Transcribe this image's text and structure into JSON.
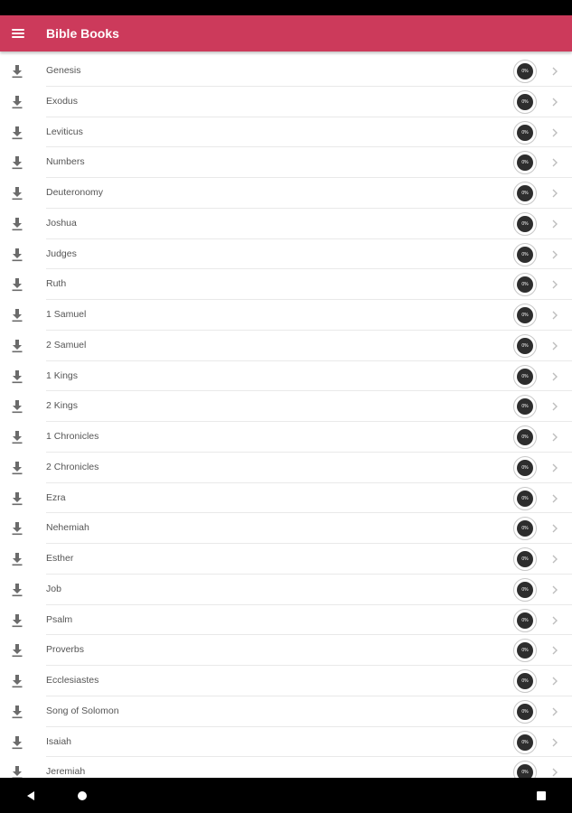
{
  "theme": {
    "accent": "#cc3a5b",
    "text": "#555555",
    "divider": "#e9e9e9",
    "progress_fill": "#2d2d2d"
  },
  "app_bar": {
    "title": "Bible Books",
    "menu_icon": "hamburger-menu-icon"
  },
  "books": [
    {
      "name": "Genesis",
      "progress": "0%"
    },
    {
      "name": "Exodus",
      "progress": "0%"
    },
    {
      "name": "Leviticus",
      "progress": "0%"
    },
    {
      "name": "Numbers",
      "progress": "0%"
    },
    {
      "name": "Deuteronomy",
      "progress": "0%"
    },
    {
      "name": "Joshua",
      "progress": "0%"
    },
    {
      "name": "Judges",
      "progress": "0%"
    },
    {
      "name": "Ruth",
      "progress": "0%"
    },
    {
      "name": "1 Samuel",
      "progress": "0%"
    },
    {
      "name": "2 Samuel",
      "progress": "0%"
    },
    {
      "name": "1 Kings",
      "progress": "0%"
    },
    {
      "name": "2 Kings",
      "progress": "0%"
    },
    {
      "name": "1 Chronicles",
      "progress": "0%"
    },
    {
      "name": "2 Chronicles",
      "progress": "0%"
    },
    {
      "name": "Ezra",
      "progress": "0%"
    },
    {
      "name": "Nehemiah",
      "progress": "0%"
    },
    {
      "name": "Esther",
      "progress": "0%"
    },
    {
      "name": "Job",
      "progress": "0%"
    },
    {
      "name": "Psalm",
      "progress": "0%"
    },
    {
      "name": "Proverbs",
      "progress": "0%"
    },
    {
      "name": "Ecclesiastes",
      "progress": "0%"
    },
    {
      "name": "Song of Solomon",
      "progress": "0%"
    },
    {
      "name": "Isaiah",
      "progress": "0%"
    },
    {
      "name": "Jeremiah",
      "progress": "0%"
    }
  ],
  "row_icons": {
    "download": "download-icon",
    "chevron": "chevron-right-icon"
  },
  "nav_bar": {
    "back": "back-icon",
    "home": "home-icon",
    "recents": "recents-icon"
  }
}
